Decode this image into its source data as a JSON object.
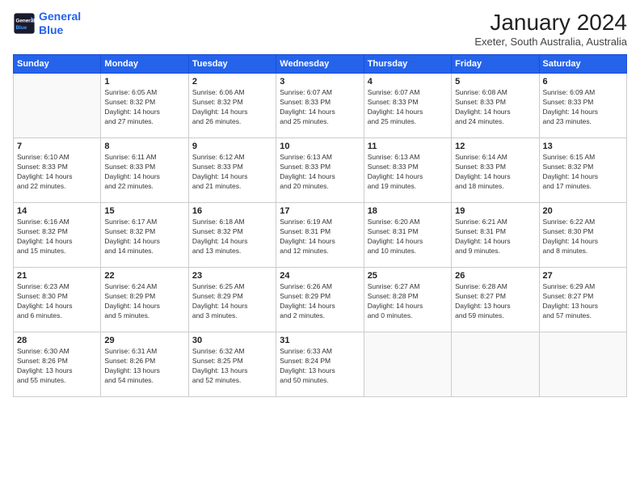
{
  "logo": {
    "line1": "General",
    "line2": "Blue"
  },
  "title": "January 2024",
  "subtitle": "Exeter, South Australia, Australia",
  "days_of_week": [
    "Sunday",
    "Monday",
    "Tuesday",
    "Wednesday",
    "Thursday",
    "Friday",
    "Saturday"
  ],
  "weeks": [
    [
      {
        "day": "",
        "info": ""
      },
      {
        "day": "1",
        "info": "Sunrise: 6:05 AM\nSunset: 8:32 PM\nDaylight: 14 hours\nand 27 minutes."
      },
      {
        "day": "2",
        "info": "Sunrise: 6:06 AM\nSunset: 8:32 PM\nDaylight: 14 hours\nand 26 minutes."
      },
      {
        "day": "3",
        "info": "Sunrise: 6:07 AM\nSunset: 8:33 PM\nDaylight: 14 hours\nand 25 minutes."
      },
      {
        "day": "4",
        "info": "Sunrise: 6:07 AM\nSunset: 8:33 PM\nDaylight: 14 hours\nand 25 minutes."
      },
      {
        "day": "5",
        "info": "Sunrise: 6:08 AM\nSunset: 8:33 PM\nDaylight: 14 hours\nand 24 minutes."
      },
      {
        "day": "6",
        "info": "Sunrise: 6:09 AM\nSunset: 8:33 PM\nDaylight: 14 hours\nand 23 minutes."
      }
    ],
    [
      {
        "day": "7",
        "info": "Sunrise: 6:10 AM\nSunset: 8:33 PM\nDaylight: 14 hours\nand 22 minutes."
      },
      {
        "day": "8",
        "info": "Sunrise: 6:11 AM\nSunset: 8:33 PM\nDaylight: 14 hours\nand 22 minutes."
      },
      {
        "day": "9",
        "info": "Sunrise: 6:12 AM\nSunset: 8:33 PM\nDaylight: 14 hours\nand 21 minutes."
      },
      {
        "day": "10",
        "info": "Sunrise: 6:13 AM\nSunset: 8:33 PM\nDaylight: 14 hours\nand 20 minutes."
      },
      {
        "day": "11",
        "info": "Sunrise: 6:13 AM\nSunset: 8:33 PM\nDaylight: 14 hours\nand 19 minutes."
      },
      {
        "day": "12",
        "info": "Sunrise: 6:14 AM\nSunset: 8:33 PM\nDaylight: 14 hours\nand 18 minutes."
      },
      {
        "day": "13",
        "info": "Sunrise: 6:15 AM\nSunset: 8:32 PM\nDaylight: 14 hours\nand 17 minutes."
      }
    ],
    [
      {
        "day": "14",
        "info": "Sunrise: 6:16 AM\nSunset: 8:32 PM\nDaylight: 14 hours\nand 15 minutes."
      },
      {
        "day": "15",
        "info": "Sunrise: 6:17 AM\nSunset: 8:32 PM\nDaylight: 14 hours\nand 14 minutes."
      },
      {
        "day": "16",
        "info": "Sunrise: 6:18 AM\nSunset: 8:32 PM\nDaylight: 14 hours\nand 13 minutes."
      },
      {
        "day": "17",
        "info": "Sunrise: 6:19 AM\nSunset: 8:31 PM\nDaylight: 14 hours\nand 12 minutes."
      },
      {
        "day": "18",
        "info": "Sunrise: 6:20 AM\nSunset: 8:31 PM\nDaylight: 14 hours\nand 10 minutes."
      },
      {
        "day": "19",
        "info": "Sunrise: 6:21 AM\nSunset: 8:31 PM\nDaylight: 14 hours\nand 9 minutes."
      },
      {
        "day": "20",
        "info": "Sunrise: 6:22 AM\nSunset: 8:30 PM\nDaylight: 14 hours\nand 8 minutes."
      }
    ],
    [
      {
        "day": "21",
        "info": "Sunrise: 6:23 AM\nSunset: 8:30 PM\nDaylight: 14 hours\nand 6 minutes."
      },
      {
        "day": "22",
        "info": "Sunrise: 6:24 AM\nSunset: 8:29 PM\nDaylight: 14 hours\nand 5 minutes."
      },
      {
        "day": "23",
        "info": "Sunrise: 6:25 AM\nSunset: 8:29 PM\nDaylight: 14 hours\nand 3 minutes."
      },
      {
        "day": "24",
        "info": "Sunrise: 6:26 AM\nSunset: 8:29 PM\nDaylight: 14 hours\nand 2 minutes."
      },
      {
        "day": "25",
        "info": "Sunrise: 6:27 AM\nSunset: 8:28 PM\nDaylight: 14 hours\nand 0 minutes."
      },
      {
        "day": "26",
        "info": "Sunrise: 6:28 AM\nSunset: 8:27 PM\nDaylight: 13 hours\nand 59 minutes."
      },
      {
        "day": "27",
        "info": "Sunrise: 6:29 AM\nSunset: 8:27 PM\nDaylight: 13 hours\nand 57 minutes."
      }
    ],
    [
      {
        "day": "28",
        "info": "Sunrise: 6:30 AM\nSunset: 8:26 PM\nDaylight: 13 hours\nand 55 minutes."
      },
      {
        "day": "29",
        "info": "Sunrise: 6:31 AM\nSunset: 8:26 PM\nDaylight: 13 hours\nand 54 minutes."
      },
      {
        "day": "30",
        "info": "Sunrise: 6:32 AM\nSunset: 8:25 PM\nDaylight: 13 hours\nand 52 minutes."
      },
      {
        "day": "31",
        "info": "Sunrise: 6:33 AM\nSunset: 8:24 PM\nDaylight: 13 hours\nand 50 minutes."
      },
      {
        "day": "",
        "info": ""
      },
      {
        "day": "",
        "info": ""
      },
      {
        "day": "",
        "info": ""
      }
    ]
  ]
}
